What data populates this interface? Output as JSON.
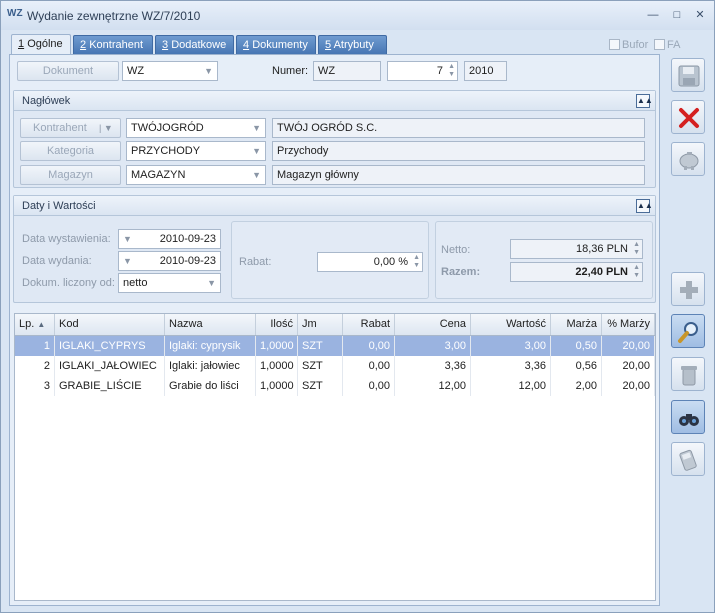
{
  "window": {
    "title": "Wydanie zewnętrzne WZ/7/2010",
    "app_icon": "WZ"
  },
  "tabs": [
    {
      "num": "1",
      "label": "Ogólne",
      "active": true
    },
    {
      "num": "2",
      "label": "Kontrahent"
    },
    {
      "num": "3",
      "label": "Dodatkowe"
    },
    {
      "num": "4",
      "label": "Dokumenty"
    },
    {
      "num": "5",
      "label": "Atrybuty"
    }
  ],
  "options": {
    "bufor": "Bufor",
    "fa": "FA"
  },
  "document": {
    "button": "Dokument",
    "type": "WZ",
    "number_label": "Numer:",
    "series": "WZ",
    "number": "7",
    "year": "2010"
  },
  "naglowek": {
    "title": "Nagłówek",
    "kontrahent_btn": "Kontrahent",
    "kontrahent_code": "TWÓJOGRÓD",
    "kontrahent_name": "TWÓJ OGRÓD S.C.",
    "kategoria_btn": "Kategoria",
    "kategoria_code": "PRZYCHODY",
    "kategoria_name": "Przychody",
    "magazyn_btn": "Magazyn",
    "magazyn_code": "MAGAZYN",
    "magazyn_name": "Magazyn główny"
  },
  "daty": {
    "title": "Daty i Wartości",
    "data_wystawienia_label": "Data wystawienia:",
    "data_wystawienia": "2010-09-23",
    "data_wydania_label": "Data wydania:",
    "data_wydania": "2010-09-23",
    "dokum_label": "Dokum. liczony od:",
    "dokum_value": "netto",
    "rabat_label": "Rabat:",
    "rabat_value": "0,00 %",
    "netto_label": "Netto:",
    "netto_value": "18,36 PLN",
    "razem_label": "Razem:",
    "razem_value": "22,40 PLN"
  },
  "table": {
    "headers": [
      "Lp.",
      "Kod",
      "Nazwa",
      "Ilość",
      "Jm",
      "Rabat",
      "Cena",
      "Wartość",
      "Marża",
      "% Marży"
    ],
    "sort_indicator": "▲",
    "rows": [
      [
        "1",
        "IGLAKI_CYPRYS",
        "Iglaki: cyprysik",
        "1,0000",
        "SZT",
        "0,00",
        "3,00",
        "3,00",
        "0,50",
        "20,00"
      ],
      [
        "2",
        "IGLAKI_JAŁOWIEC",
        "Iglaki: jałowiec",
        "1,0000",
        "SZT",
        "0,00",
        "3,36",
        "3,36",
        "0,56",
        "20,00"
      ],
      [
        "3",
        "GRABIE_LIŚCIE",
        "Grabie do liści",
        "1,0000",
        "SZT",
        "0,00",
        "12,00",
        "12,00",
        "2,00",
        "20,00"
      ]
    ]
  },
  "toolbar": [
    {
      "name": "save-icon"
    },
    {
      "name": "cancel-icon"
    },
    {
      "name": "piggy-bank-icon"
    },
    {
      "name": "add-icon"
    },
    {
      "name": "edit-magnifier-icon"
    },
    {
      "name": "delete-trash-icon"
    },
    {
      "name": "binoculars-icon"
    },
    {
      "name": "payment-terminal-icon"
    }
  ],
  "colors": {
    "tab_blue": "#4574b2",
    "selection": "#9ab3e0",
    "cancel_red": "#d42020"
  }
}
